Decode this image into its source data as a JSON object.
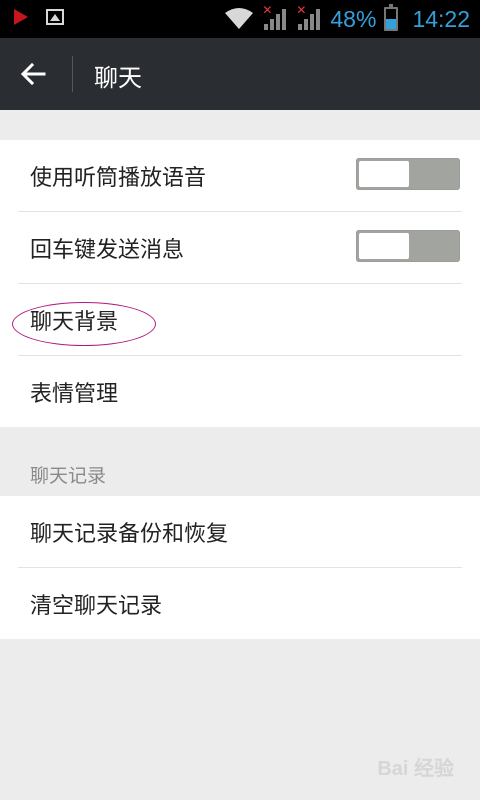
{
  "status_bar": {
    "battery_percent": "48%",
    "battery_level": 0.48,
    "time": "14:22",
    "icons": [
      "play-store-icon",
      "gallery-icon",
      "wifi-icon",
      "signal-icon",
      "battery-icon"
    ]
  },
  "action_bar": {
    "title": "聊天"
  },
  "settings": {
    "use_earpiece": {
      "label": "使用听筒播放语音",
      "on": false
    },
    "enter_to_send": {
      "label": "回车键发送消息",
      "on": false
    },
    "chat_background": {
      "label": "聊天背景"
    },
    "emoji_management": {
      "label": "表情管理"
    }
  },
  "history_section": {
    "header": "聊天记录",
    "backup_restore": {
      "label": "聊天记录备份和恢复"
    },
    "clear_history": {
      "label": "清空聊天记录"
    }
  },
  "watermark": "Bai 经验",
  "colors": {
    "accent": "#33a0dc",
    "action_bar": "#2a2e33",
    "annotation": "#b0187e"
  }
}
